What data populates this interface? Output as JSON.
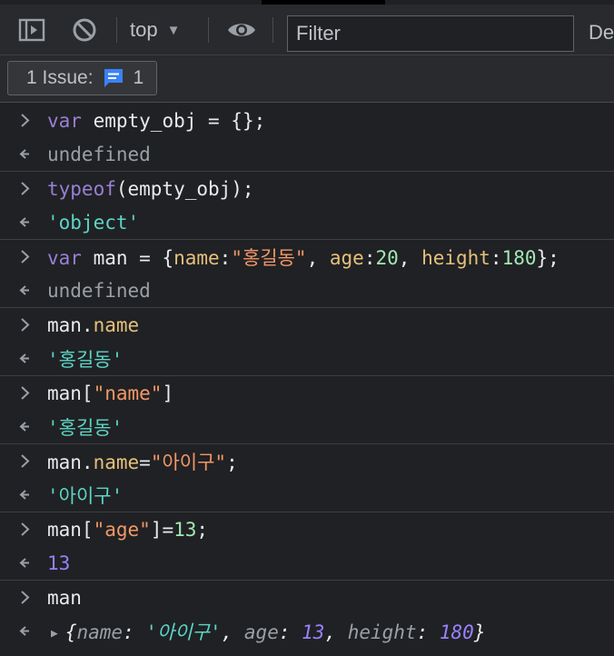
{
  "toolbar": {
    "context": "top",
    "filter_placeholder": "Filter",
    "levels_label": "De"
  },
  "issues": {
    "label": "1 Issue:",
    "count": "1"
  },
  "console": {
    "e1": {
      "in_kw": "var",
      "in_rest": " empty_obj = {};",
      "out": "undefined"
    },
    "e2": {
      "in_kw": "typeof",
      "in_rest": "(empty_obj);",
      "out": "'object'"
    },
    "e3": {
      "in_kw": "var",
      "in_a": " man = {",
      "in_k1": "name",
      "in_c1": ":",
      "in_v1": "\"홍길동\"",
      "in_s1": ", ",
      "in_k2": "age",
      "in_c2": ":",
      "in_v2": "20",
      "in_s2": ", ",
      "in_k3": "height",
      "in_c3": ":",
      "in_v3": "180",
      "in_end": "};",
      "out": "undefined"
    },
    "e4": {
      "in_obj": "man.",
      "in_prop": "name",
      "out": "'홍길동'"
    },
    "e5": {
      "in_obj": "man[",
      "in_str": "\"name\"",
      "in_end": "]",
      "out": "'홍길동'"
    },
    "e6": {
      "in_obj": "man.",
      "in_prop": "name",
      "in_eq": "=",
      "in_str": "\"아이구\"",
      "in_end": ";",
      "out": "'아이구'"
    },
    "e7": {
      "in_obj": "man[",
      "in_str": "\"age\"",
      "in_eq": "]=",
      "in_num": "13",
      "in_end": ";",
      "out": "13"
    },
    "e8": {
      "in": "man",
      "out_open": "{",
      "out_k1": "name",
      "out_c1": ": ",
      "out_v1": "'아이구'",
      "out_s1": ", ",
      "out_k2": "age",
      "out_c2": ": ",
      "out_v2": "13",
      "out_s2": ", ",
      "out_k3": "height",
      "out_c3": ": ",
      "out_v3": "180",
      "out_close": "}"
    }
  },
  "icons": {
    "sidebar": "sidebar-toggle-icon",
    "clear": "clear-console-icon",
    "eye": "live-expression-eye-icon",
    "issue": "issue-message-icon",
    "input_prompt": "input-chevron-icon",
    "output_prompt": "output-return-arrow-icon"
  },
  "colors": {
    "background": "#202124",
    "toolbar": "#292a2d",
    "keyword": "#9a7fd5",
    "property": "#e5c07b",
    "string": "#5cd5c6",
    "number_out": "#9980ff",
    "issue_blue": "#3b82f6"
  }
}
